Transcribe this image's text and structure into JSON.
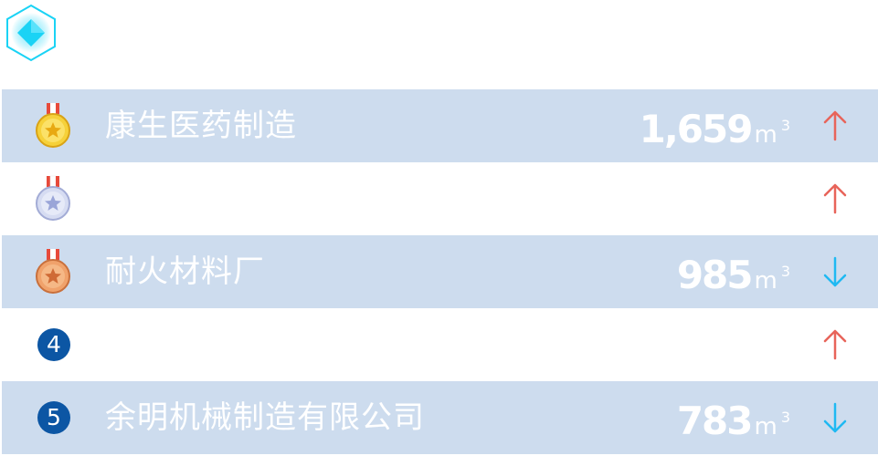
{
  "colors": {
    "row_shaded": "#cddcee",
    "up_arrow": "#e8645a",
    "down_arrow": "#1fb9f2",
    "rank_badge": "#0c56a4",
    "logo_accent": "#1ad3f5"
  },
  "units": {
    "base": "m",
    "exponent": "3"
  },
  "ranking": [
    {
      "rank": "1",
      "medal": "gold-medal-icon",
      "name": "康生医药制造",
      "value": "1,659",
      "trend": "up"
    },
    {
      "rank": "2",
      "medal": "silver-medal-icon",
      "name": "",
      "value": "",
      "trend": "up"
    },
    {
      "rank": "3",
      "medal": "bronze-medal-icon",
      "name": "耐火材料厂",
      "value": "985",
      "trend": "down"
    },
    {
      "rank": "4",
      "medal": "",
      "name": "",
      "value": "",
      "trend": "up"
    },
    {
      "rank": "5",
      "medal": "",
      "name": "余明机械制造有限公司",
      "value": "783",
      "trend": "down"
    }
  ]
}
